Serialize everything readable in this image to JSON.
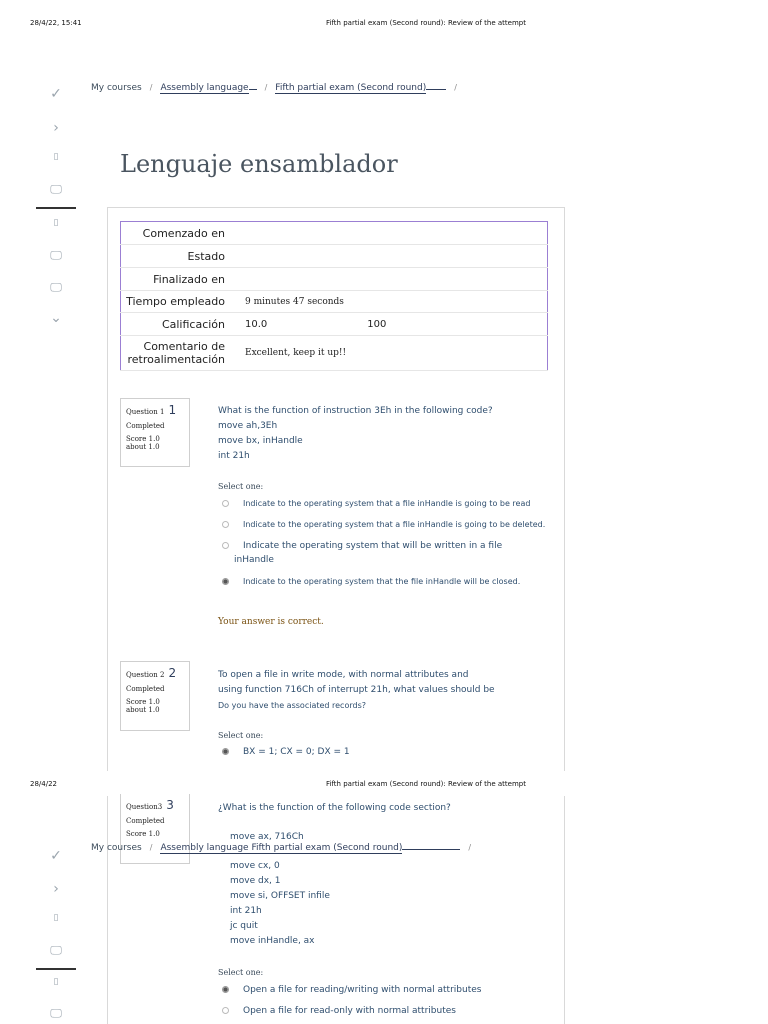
{
  "print_header": {
    "date_p1": "28/4/22, 15:41",
    "title": "Fifth partial exam (Second round): Review of the attempt",
    "date_p2": "28/4/22"
  },
  "breadcrumb": {
    "items": [
      "My courses",
      "Assembly language",
      "Fifth partial exam (Second round)"
    ],
    "p2_items": [
      "My courses",
      "Assembly language Fifth partial exam (Second round)"
    ]
  },
  "sidebar": {
    "check_glyph": "✓",
    "chevron_right_glyph": "›",
    "box_glyph": "▯",
    "monitor_glyph": "🖵",
    "chevron_down_glyph": "⌄"
  },
  "page_title": "Lenguaje ensamblador",
  "summary": {
    "rows": [
      {
        "label": "Comenzado en",
        "value": ""
      },
      {
        "label": "Estado",
        "value": ""
      },
      {
        "label": "Finalizado en",
        "value": ""
      },
      {
        "label": "Tiempo empleado",
        "value": "9 minutes 47 seconds"
      },
      {
        "label": "Calificación",
        "value": "10.0",
        "value2": "100"
      },
      {
        "label": "Comentario de retroalimentación",
        "value": "Excellent, keep it up!!"
      }
    ]
  },
  "questions": [
    {
      "label": "Question 1",
      "num": "1",
      "state": "Completed",
      "score": "Score 1.0",
      "about": "about 1.0",
      "text": [
        "What is the function of instruction 3Eh in the following code?",
        "move ah,3Eh",
        "move  bx,  inHandle",
        "int 21h"
      ],
      "select_one": "Select one:",
      "options": [
        "Indicate to the operating system that a file inHandle is going to be read",
        "Indicate to the operating system that a file inHandle is going to be deleted.",
        "Indicate the operating system that will be written in a file",
        "inHandle",
        "Indicate to the operating system that the file inHandle will be closed."
      ],
      "feedback": "Your answer is correct."
    },
    {
      "label": "Question 2",
      "num": "2",
      "state": "Completed",
      "score": "Score 1.0",
      "about": "about 1.0",
      "text": [
        "To open a file in write mode, with normal attributes and",
        "using function 716Ch of interrupt 21h, what values should be",
        "Do you have the associated records?"
      ],
      "select_one": "Select one:",
      "options": [
        "BX = 1; CX = 0; DX = 1"
      ]
    },
    {
      "label": "Question3",
      "num": "3",
      "state": "Completed",
      "score": "Score 1.0",
      "text": [
        "¿What is the function of the following code section?",
        "move ax, 716Ch",
        "move cx, 0",
        "move dx, 1",
        "move si, OFFSET infile",
        "int 21h",
        "jc quit",
        "move inHandle, ax"
      ],
      "select_one": "Select one:",
      "options": [
        "Open a file for reading/writing with normal attributes",
        "Open a file for read-only with normal attributes"
      ]
    }
  ]
}
